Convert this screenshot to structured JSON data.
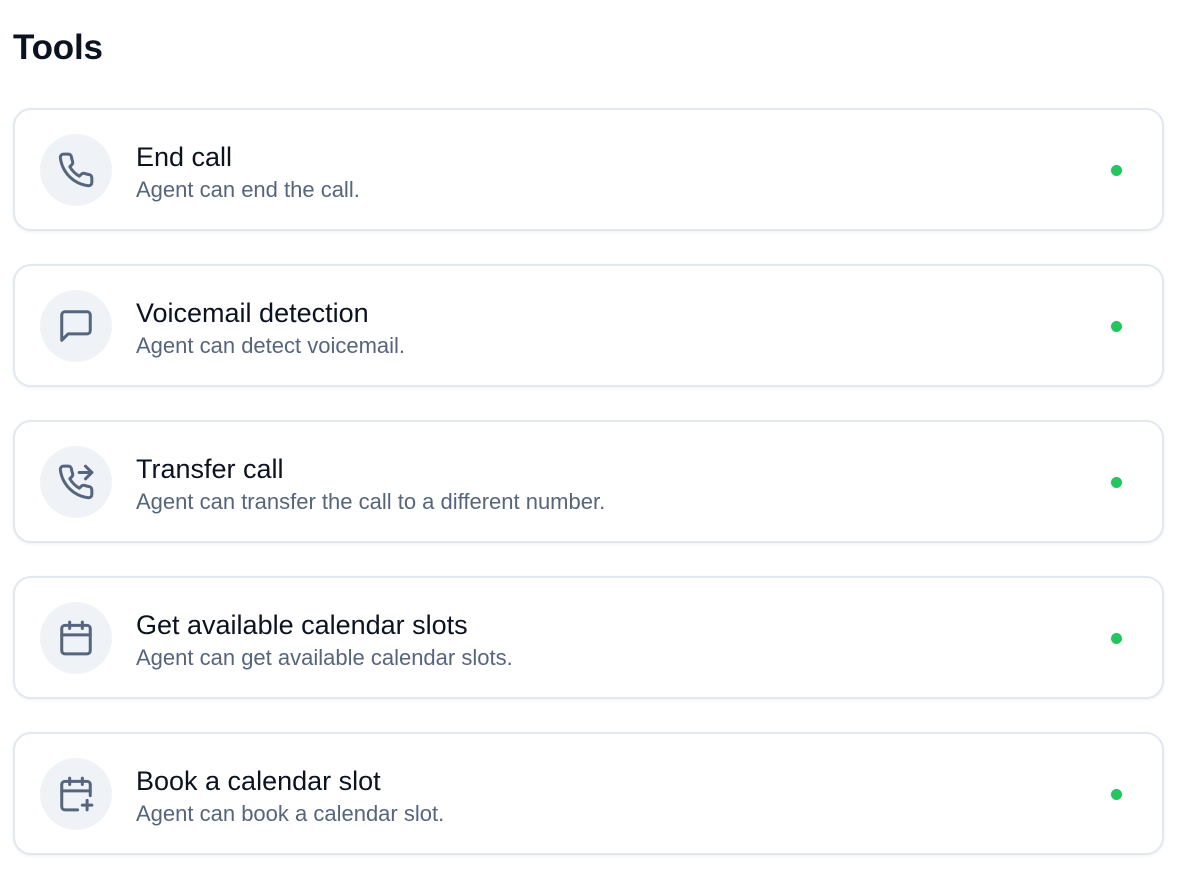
{
  "page": {
    "title": "Tools"
  },
  "colors": {
    "status_active": "#22c55e",
    "icon_stroke": "#56657e",
    "icon_background": "#eff3f8",
    "card_border": "#e2e8f0"
  },
  "tools": [
    {
      "name": "End call",
      "description": "Agent can end the call.",
      "icon": "phone-icon",
      "status": "active"
    },
    {
      "name": "Voicemail detection",
      "description": "Agent can detect voicemail.",
      "icon": "message-square-icon",
      "status": "active"
    },
    {
      "name": "Transfer call",
      "description": "Agent can transfer the call to a different number.",
      "icon": "phone-forwarded-icon",
      "status": "active"
    },
    {
      "name": "Get available calendar slots",
      "description": "Agent can get available calendar slots.",
      "icon": "calendar-icon",
      "status": "active"
    },
    {
      "name": "Book a calendar slot",
      "description": "Agent can book a calendar slot.",
      "icon": "calendar-plus-icon",
      "status": "active"
    }
  ]
}
